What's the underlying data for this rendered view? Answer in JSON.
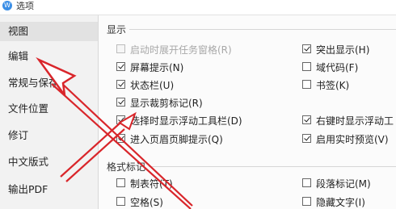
{
  "window": {
    "title": "选项"
  },
  "sidebar": {
    "items": [
      {
        "label": "视图",
        "active": true
      },
      {
        "label": "编辑"
      },
      {
        "label": "常规与保存"
      },
      {
        "label": "文件位置"
      },
      {
        "label": "修订"
      },
      {
        "label": "中文版式"
      },
      {
        "label": "输出PDF"
      }
    ]
  },
  "sections": {
    "display": {
      "title": "显示",
      "left": [
        {
          "label": "启动时展开任务窗格(R)",
          "checked": false,
          "disabled": true
        },
        {
          "label": "屏幕提示(N)",
          "checked": true
        },
        {
          "label": "状态栏(U)",
          "checked": true
        },
        {
          "label": "显示裁剪标记(R)",
          "checked": true
        },
        {
          "label": "选择时显示浮动工具栏(D)",
          "checked": true
        },
        {
          "label": "进入页眉页脚提示(Q)",
          "checked": true
        }
      ],
      "right": [
        {
          "label": "突出显示(H)",
          "checked": true
        },
        {
          "label": "域代码(F)",
          "checked": false
        },
        {
          "label": "书签(K)",
          "checked": false
        },
        {
          "label": "右键时显示浮动工",
          "checked": true
        },
        {
          "label": "启用实时预览(V)",
          "checked": true
        }
      ]
    },
    "format_marks": {
      "title": "格式标记",
      "left": [
        {
          "label": "制表符(T)",
          "checked": false
        },
        {
          "label": "空格(S)",
          "checked": false
        }
      ],
      "right": [
        {
          "label": "段落标记(M)",
          "checked": false
        },
        {
          "label": "隐藏文字(I)",
          "checked": false
        }
      ]
    }
  },
  "colors": {
    "annotation_arrow": "#d9262b",
    "sidebar_active": "#e2e2e2"
  }
}
